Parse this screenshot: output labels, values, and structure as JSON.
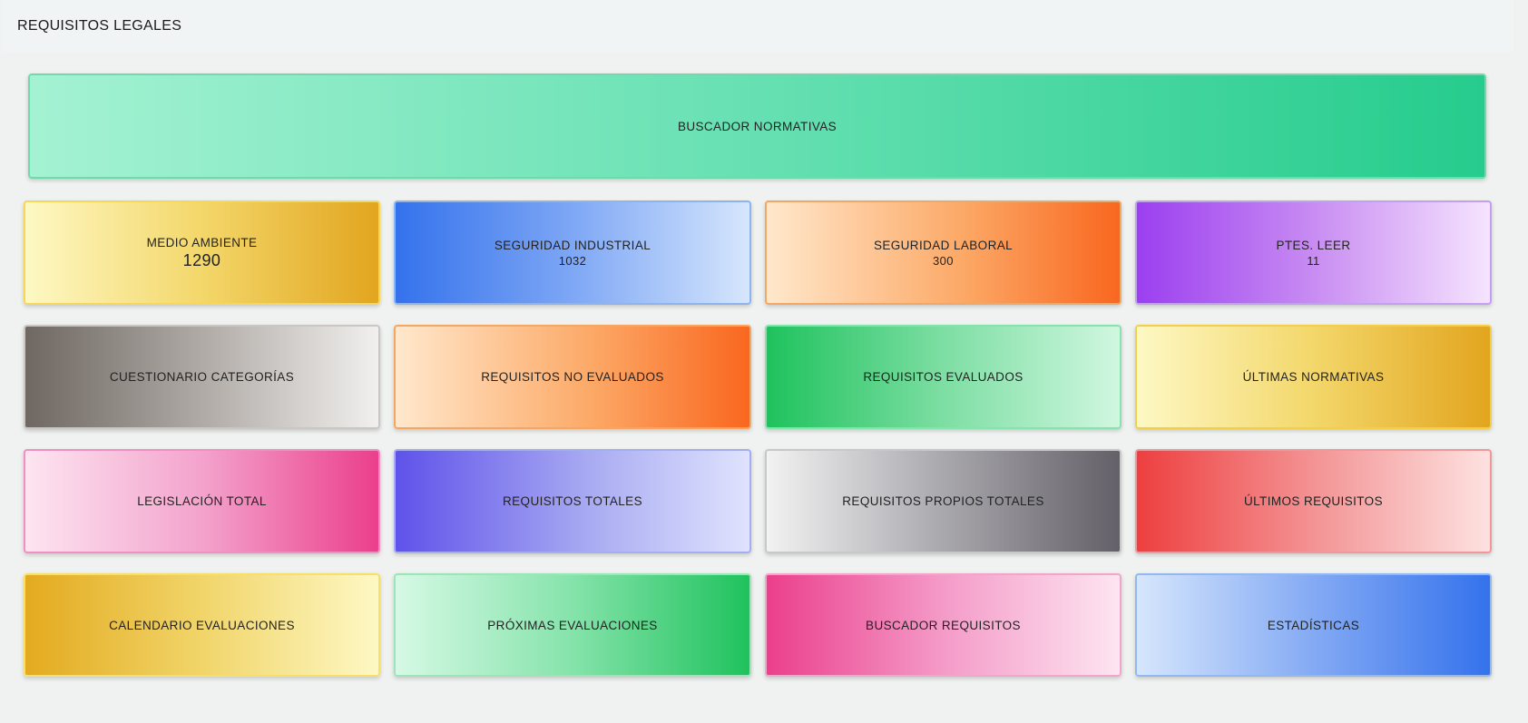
{
  "header": {
    "title": "REQUISITOS LEGALES"
  },
  "banner": {
    "label": "BUSCADOR NORMATIVAS"
  },
  "tiles": {
    "medio_ambiente": {
      "label": "MEDIO AMBIENTE",
      "count": "1290"
    },
    "seguridad_industrial": {
      "label": "SEGURIDAD INDUSTRIAL",
      "count": "1032"
    },
    "seguridad_laboral": {
      "label": "SEGURIDAD LABORAL",
      "count": "300"
    },
    "ptes_leer": {
      "label": "PTES. LEER",
      "count": "11"
    },
    "cuestionario": {
      "label": "CUESTIONARIO CATEGORÍAS"
    },
    "no_evaluados": {
      "label": "REQUISITOS NO EVALUADOS"
    },
    "evaluados": {
      "label": "REQUISITOS EVALUADOS"
    },
    "ultimas_normativas": {
      "label": "ÚLTIMAS NORMATIVAS"
    },
    "legislacion_total": {
      "label": "LEGISLACIÓN TOTAL"
    },
    "requisitos_totales": {
      "label": "REQUISITOS TOTALES"
    },
    "propios_totales": {
      "label": "REQUISITOS PROPIOS TOTALES"
    },
    "ultimos_requisitos": {
      "label": "ÚLTIMOS REQUISITOS"
    },
    "calendario": {
      "label": "CALENDARIO EVALUACIONES"
    },
    "proximas": {
      "label": "PRÓXIMAS EVALUACIONES"
    },
    "buscador_requisitos": {
      "label": "BUSCADOR REQUISITOS"
    },
    "estadisticas": {
      "label": "ESTADÍSTICAS"
    }
  }
}
